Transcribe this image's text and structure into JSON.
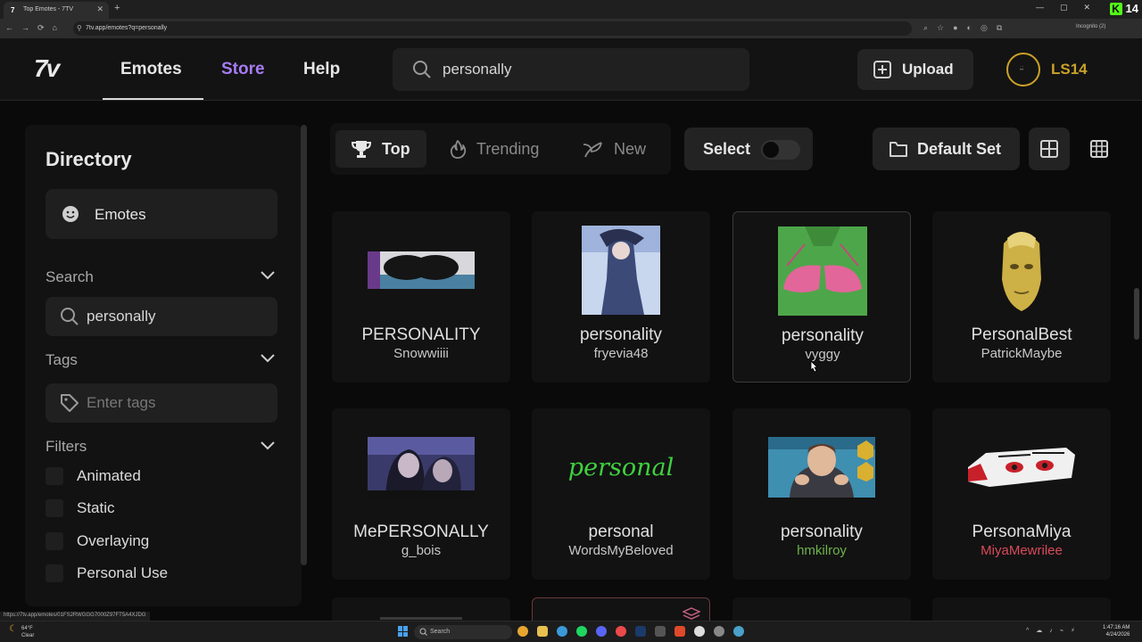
{
  "browser": {
    "tab_title": "Top Emotes - 7TV",
    "tab_favicon": "7",
    "url": "7tv.app/emotes?q=personally",
    "incognito_label": "Incognito (2)",
    "extension_badge": "14"
  },
  "header": {
    "logo": "7v",
    "nav": {
      "emotes": "Emotes",
      "store": "Store",
      "help": "Help"
    },
    "search": {
      "value": "personally"
    },
    "upload_label": "Upload",
    "username": "LS14",
    "colors": {
      "store": "#a77bf3",
      "username": "#c9a227"
    }
  },
  "sidebar": {
    "title": "Directory",
    "emotes_label": "Emotes",
    "search": {
      "label": "Search",
      "value": "personally"
    },
    "tags": {
      "label": "Tags",
      "placeholder": "Enter tags"
    },
    "filters": {
      "label": "Filters",
      "items": [
        "Animated",
        "Static",
        "Overlaying",
        "Personal Use"
      ]
    }
  },
  "toolbar": {
    "sort": {
      "top": "Top",
      "trending": "Trending",
      "new": "New"
    },
    "select_label": "Select",
    "default_set_label": "Default Set"
  },
  "emotes": [
    {
      "name": "PERSONALITY",
      "owner": "Snowwiiii",
      "owner_color": "#c8c8c8"
    },
    {
      "name": "personality",
      "owner": "fryevia48",
      "owner_color": "#c8c8c8"
    },
    {
      "name": "personality",
      "owner": "vyggy",
      "owner_color": "#c8c8c8"
    },
    {
      "name": "PersonalBest",
      "owner": "PatrickMaybe",
      "owner_color": "#c8c8c8"
    },
    {
      "name": "MePERSONALLY",
      "owner": "g_bois",
      "owner_color": "#c8c8c8"
    },
    {
      "name": "personal",
      "owner": "WordsMyBeloved",
      "owner_color": "#c8c8c8",
      "thumb_text": "personal"
    },
    {
      "name": "personality",
      "owner": "hmkilroy",
      "owner_color": "#6db34a"
    },
    {
      "name": "PersonaMiya",
      "owner": "MiyaMewrilee",
      "owner_color": "#d94a5a"
    }
  ],
  "status_url": "https://7tv.app/emotes/01FS2RWGGG7000Z97FT5A4XJDG",
  "taskbar": {
    "weather_temp": "64°F",
    "weather_desc": "Clear",
    "search_label": "Search",
    "time": "1:47:16 AM",
    "date": "4/24/2026"
  }
}
